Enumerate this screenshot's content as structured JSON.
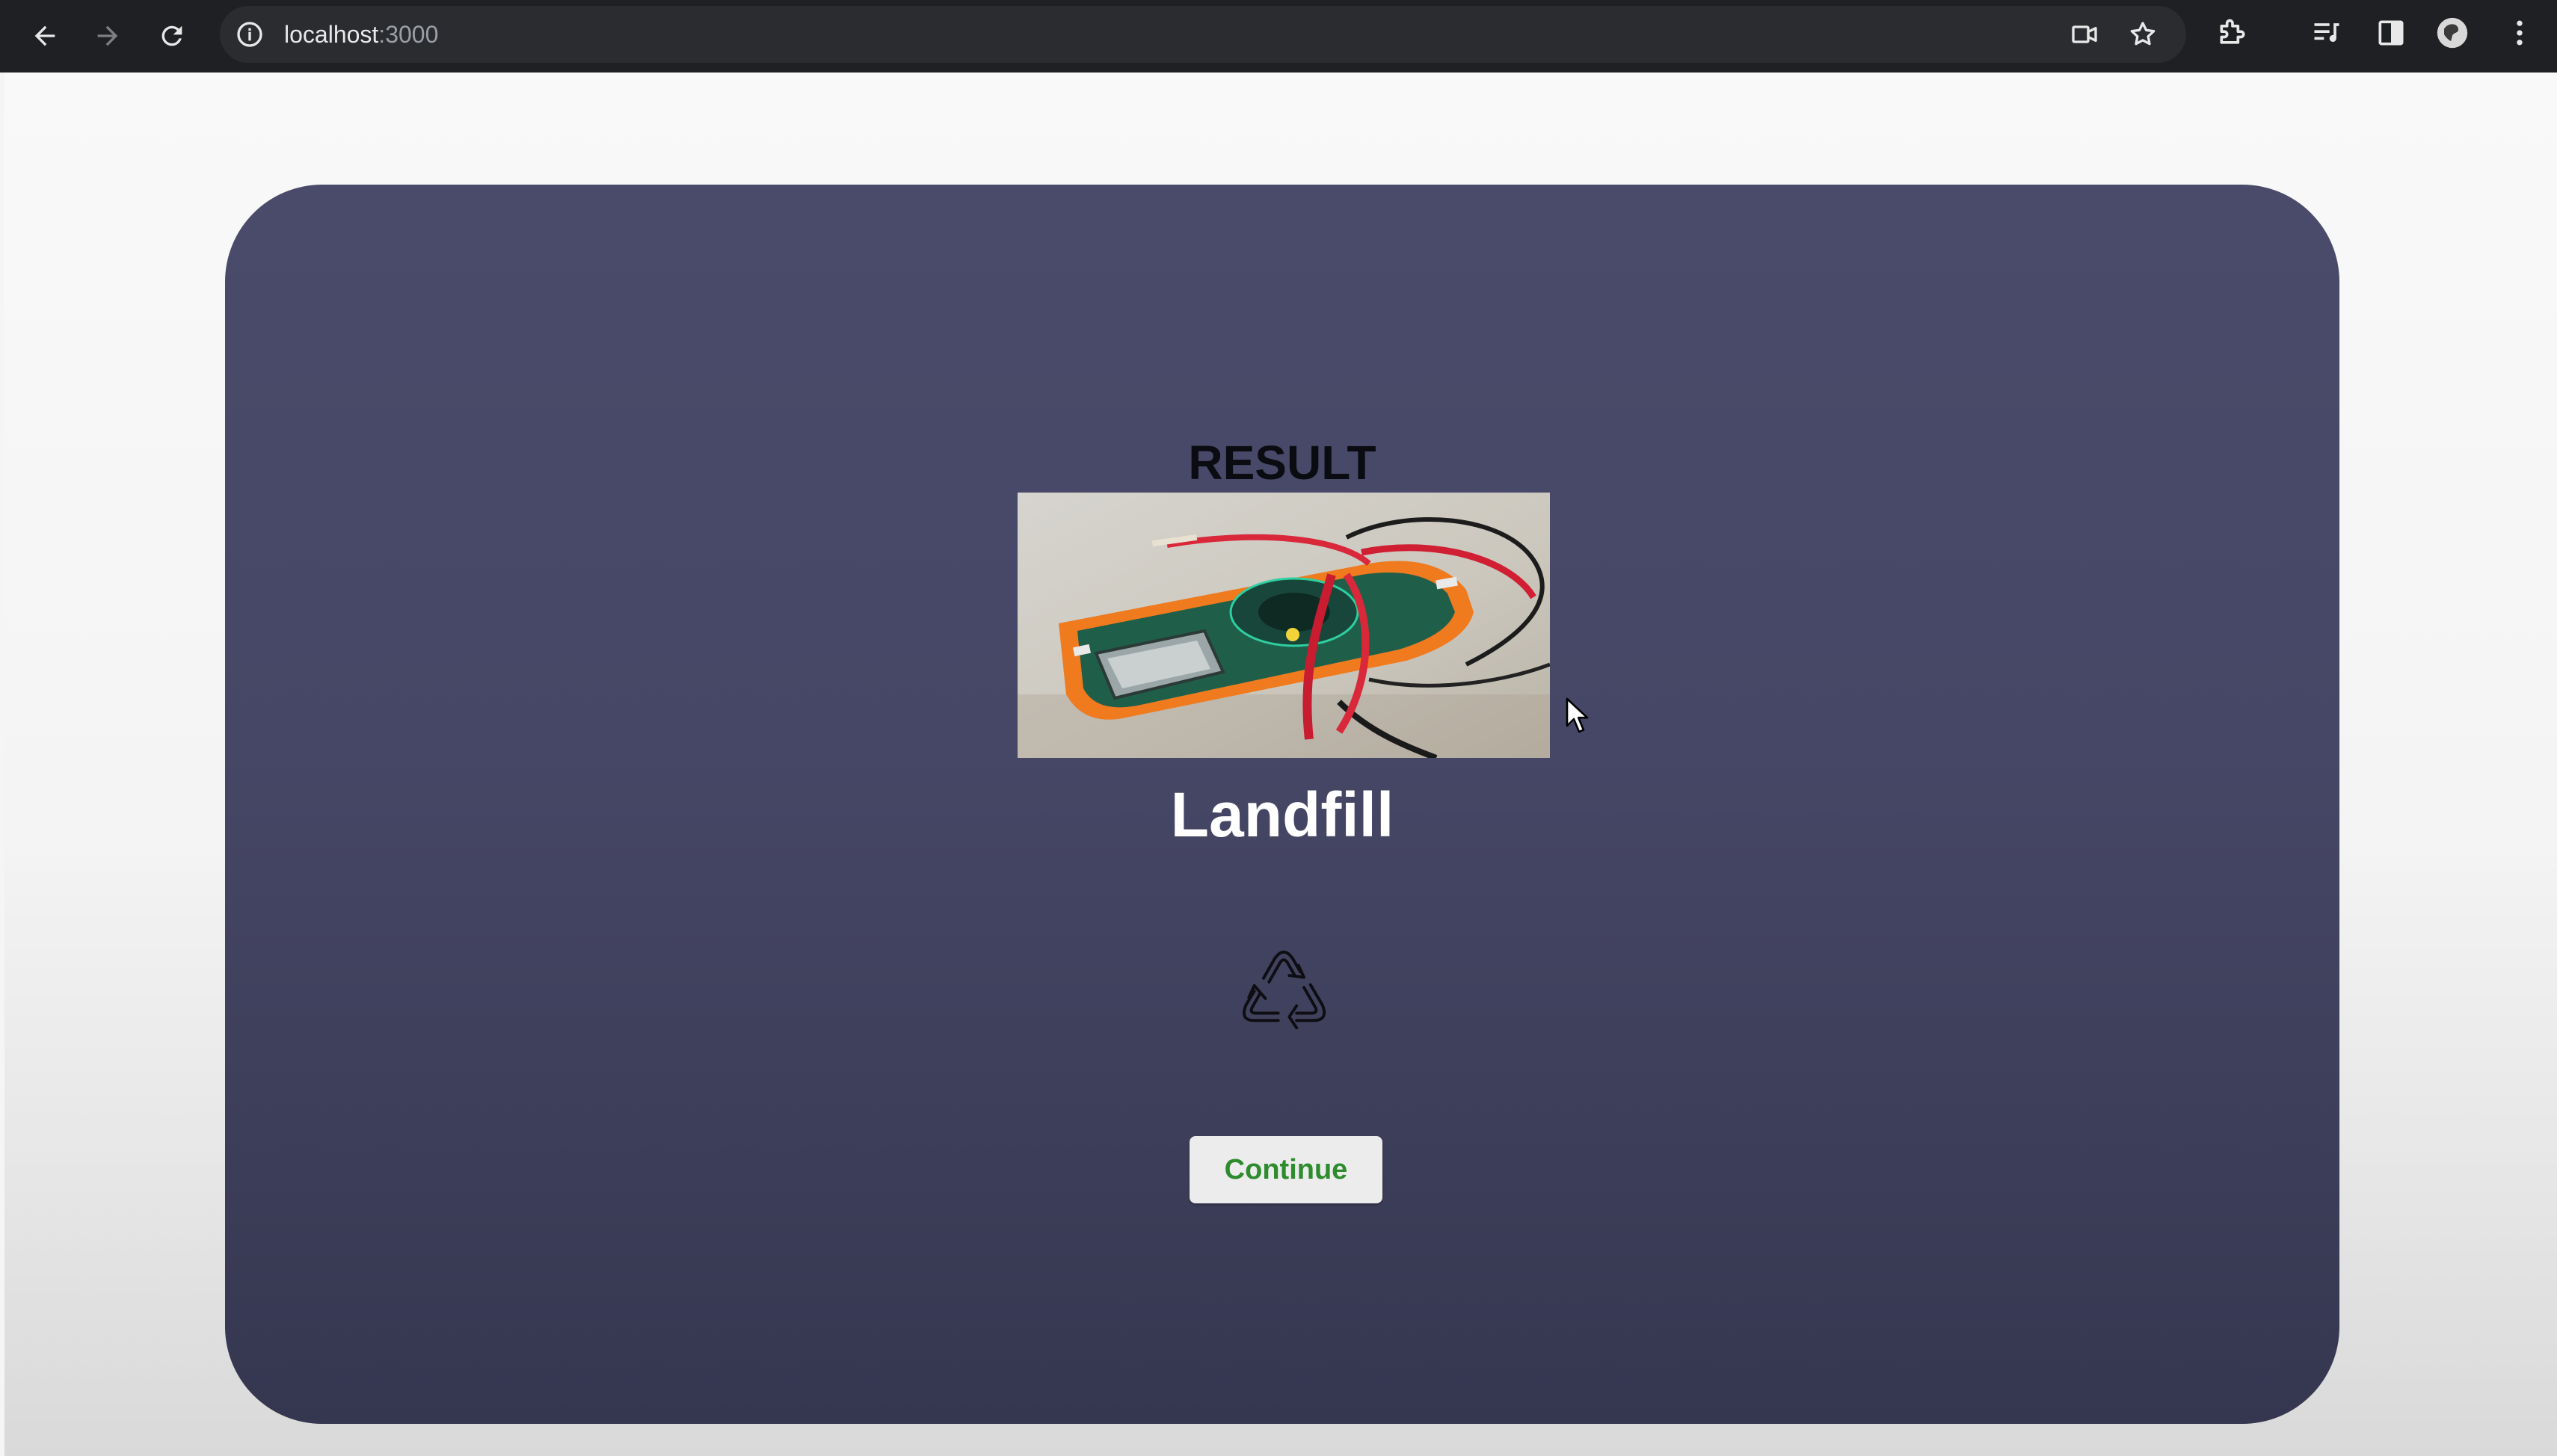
{
  "browser": {
    "url_host": "localhost",
    "url_port": ":3000",
    "icons": {
      "back": "arrow-left-icon",
      "forward": "arrow-right-icon",
      "reload": "reload-icon",
      "site_info": "info-icon",
      "camera": "video-camera-icon",
      "bookmark": "star-icon",
      "extensions": "puzzle-icon",
      "media": "media-queue-icon",
      "side_panel": "side-panel-icon",
      "profile": "avatar",
      "menu": "kebab-menu-icon"
    }
  },
  "result": {
    "title": "RESULT",
    "category": "Landfill",
    "image_subject": "multimeter-photo",
    "symbol": "recycle-icon",
    "continue_label": "Continue"
  },
  "colors": {
    "card_top": "#4a4b6a",
    "card_bottom": "#353650",
    "button_text": "#2e8b2e",
    "button_bg": "#ececec"
  }
}
